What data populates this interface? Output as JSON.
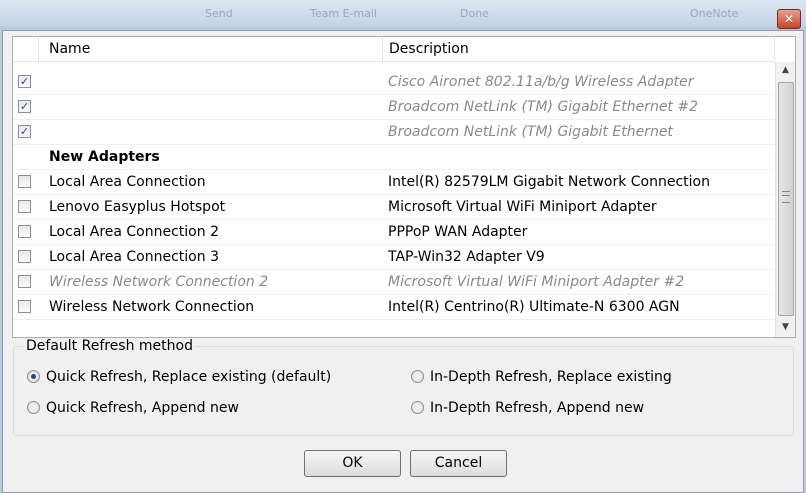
{
  "toolbar": {
    "items": [
      "Send",
      "Team E-mail",
      "Done",
      "OneNote"
    ]
  },
  "window": {
    "close_glyph": "✕"
  },
  "list": {
    "columns": {
      "name": "Name",
      "description": "Description"
    },
    "rows": [
      {
        "type": "item",
        "checked": true,
        "name": "",
        "description": "Cisco Aironet 802.11a/b/g Wireless Adapter",
        "dimmed": true
      },
      {
        "type": "item",
        "checked": true,
        "name": "",
        "description": "Broadcom NetLink (TM) Gigabit Ethernet #2",
        "dimmed": true
      },
      {
        "type": "item",
        "checked": true,
        "name": "",
        "description": "Broadcom NetLink (TM) Gigabit Ethernet",
        "dimmed": true
      },
      {
        "type": "group",
        "name": "New Adapters"
      },
      {
        "type": "item",
        "checked": false,
        "name": "Local Area Connection",
        "description": "Intel(R) 82579LM Gigabit Network Connection",
        "dimmed": false
      },
      {
        "type": "item",
        "checked": false,
        "name": "Lenovo Easyplus Hotspot",
        "description": "Microsoft Virtual WiFi Miniport Adapter",
        "dimmed": false
      },
      {
        "type": "item",
        "checked": false,
        "name": "Local Area Connection 2",
        "description": "PPPoP WAN Adapter",
        "dimmed": false
      },
      {
        "type": "item",
        "checked": false,
        "name": "Local Area Connection 3",
        "description": "TAP-Win32 Adapter V9",
        "dimmed": false
      },
      {
        "type": "item",
        "checked": false,
        "name": "Wireless Network Connection 2",
        "description": "Microsoft Virtual WiFi Miniport Adapter #2",
        "dimmed": true
      },
      {
        "type": "item",
        "checked": false,
        "name": "Wireless Network Connection",
        "description": "Intel(R) Centrino(R) Ultimate-N 6300 AGN",
        "dimmed": false
      }
    ]
  },
  "refresh": {
    "legend": "Default Refresh method",
    "options": [
      {
        "label": "Quick Refresh, Replace existing (default)",
        "selected": true
      },
      {
        "label": "In-Depth Refresh, Replace existing",
        "selected": false
      },
      {
        "label": "Quick Refresh, Append new",
        "selected": false
      },
      {
        "label": "In-Depth Refresh, Append new",
        "selected": false
      }
    ]
  },
  "buttons": {
    "ok": "OK",
    "cancel": "Cancel"
  },
  "colors": {
    "dimmed_text": "#8a8a8a",
    "check": "#24458a",
    "radio_dot": "#1f4a92"
  }
}
